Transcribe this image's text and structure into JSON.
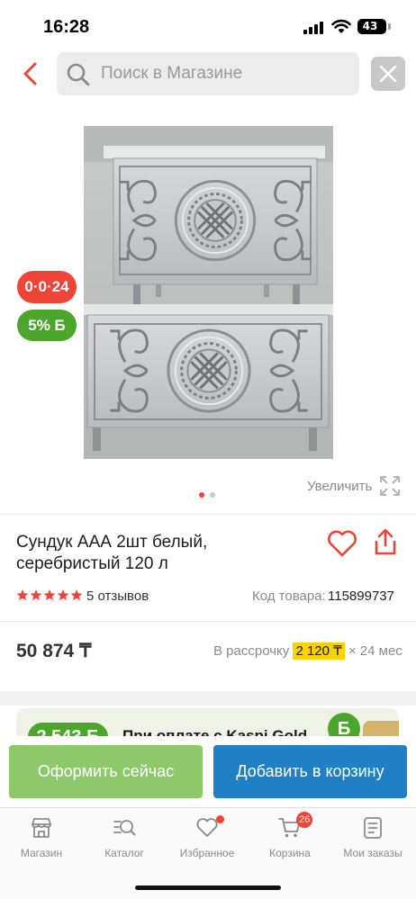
{
  "status_bar": {
    "time": "16:28",
    "battery": "43"
  },
  "search": {
    "placeholder": "Поиск в Магазине"
  },
  "badges": {
    "installment": "0·0·24",
    "bonus": "5% Б"
  },
  "gallery": {
    "zoom_label": "Увеличить",
    "current_page": 1,
    "total_pages": 2
  },
  "product": {
    "title": "Сундук ААА 2шт белый, серебристый 120 л",
    "rating_stars": 5,
    "reviews": "5 отзывов",
    "sku_label": "Код товара:",
    "sku_value": "115899737"
  },
  "price": {
    "value": "50 874 ₸",
    "installment_prefix": "В рассрочку",
    "installment_amount": "2 120 ₸",
    "installment_suffix": "× 24 мес"
  },
  "promo": {
    "amount": "2 543 Б",
    "text": "При оплате с Kaspi Gold",
    "coin": "Б"
  },
  "actions": {
    "checkout": "Оформить сейчас",
    "add_to_cart": "Добавить в корзину"
  },
  "nav": {
    "items": [
      {
        "label": "Магазин",
        "icon": "shop-icon"
      },
      {
        "label": "Каталог",
        "icon": "catalog-icon"
      },
      {
        "label": "Избранное",
        "icon": "heart-icon"
      },
      {
        "label": "Корзина",
        "icon": "cart-icon"
      },
      {
        "label": "Мои заказы",
        "icon": "orders-icon"
      }
    ],
    "cart_count": "26"
  },
  "colors": {
    "accent_red": "#f04438",
    "bonus_green": "#4aa72b",
    "checkout_green": "#8dc96a",
    "cart_blue": "#1f80c6",
    "installment_yellow": "#fad200"
  }
}
